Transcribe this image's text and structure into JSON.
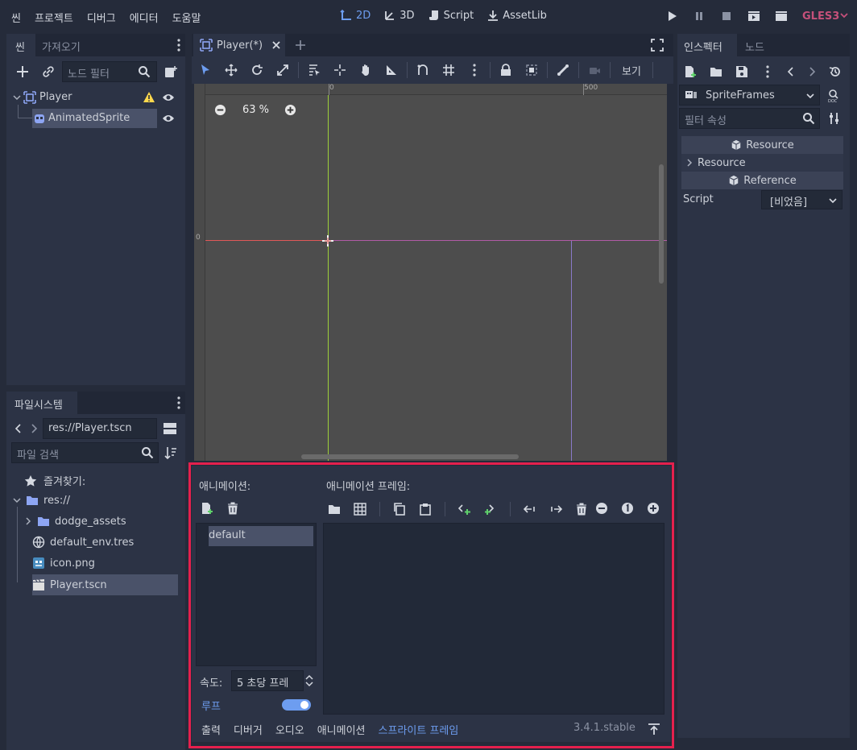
{
  "menu": {
    "items": [
      "씬",
      "프로젝트",
      "디버그",
      "에디터",
      "도움말"
    ],
    "workspaces": {
      "w2d": "2D",
      "w3d": "3D",
      "script": "Script",
      "assetlib": "AssetLib"
    },
    "renderer": "GLES3"
  },
  "scene_dock": {
    "tabs": [
      "씬",
      "가져오기"
    ],
    "filter_placeholder": "노드 필터",
    "tree": [
      {
        "name": "Player",
        "icon": "node2d-icon",
        "warning": true
      },
      {
        "name": "AnimatedSprite",
        "icon": "animated-sprite-icon",
        "selected": true
      }
    ]
  },
  "filesystem": {
    "tab": "파일시스템",
    "path": "res://Player.tscn",
    "search_placeholder": "파일 검색",
    "favorites": "즐겨찾기:",
    "root": "res://",
    "items": [
      {
        "name": "dodge_assets",
        "icon": "folder-icon"
      },
      {
        "name": "default_env.tres",
        "icon": "environment-icon"
      },
      {
        "name": "icon.png",
        "icon": "image-icon"
      },
      {
        "name": "Player.tscn",
        "icon": "scene-icon",
        "selected": true
      }
    ]
  },
  "viewport": {
    "tab_title": "Player(*)",
    "zoom": "63 %",
    "view_menu": "보기",
    "ruler_labels": {
      "x0": "0",
      "x500": "500",
      "y0": "0"
    }
  },
  "sprite_frames": {
    "animations_label": "애니메이션:",
    "frames_label": "애니메이션 프레임:",
    "animations": [
      "default"
    ],
    "speed_label": "속도:",
    "speed_value": "5 초당 프레",
    "loop_label": "루프",
    "loop_on": true
  },
  "bottom_tabs": {
    "items": [
      "출력",
      "디버거",
      "오디오",
      "애니메이션",
      "스프라이트 프레임"
    ],
    "active": 4,
    "version": "3.4.1.stable"
  },
  "inspector": {
    "tabs": [
      "인스펙터",
      "노드"
    ],
    "resource_type": "SpriteFrames",
    "filter_placeholder": "필터 속성",
    "sections": {
      "resource_header": "Resource",
      "resource_group": "Resource",
      "reference_header": "Reference"
    },
    "script_label": "Script",
    "script_value": "[비었음]"
  },
  "colors": {
    "accent": "#6d9df0",
    "warning": "#ffd84d",
    "highlight": "#e5204d",
    "renderer": "#c5507a"
  }
}
